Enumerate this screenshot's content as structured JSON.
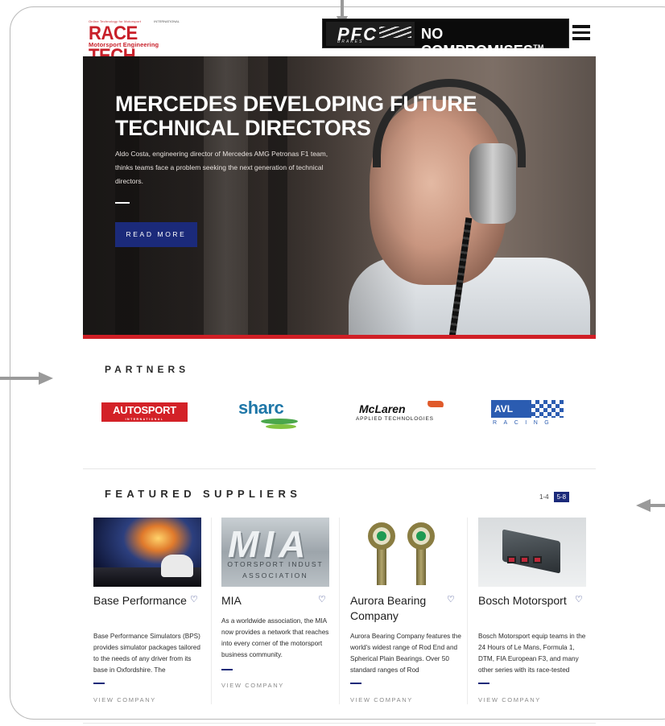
{
  "header": {
    "logo_top_left": "Online Technology for Motorsport",
    "logo_top_right": "INTERNATIONAL",
    "logo_main": "RACE TECH",
    "logo_sub": "Motorsport Engineering",
    "ad_brand": "PFC",
    "ad_brand_sub": "BRAKES",
    "ad_tagline": "NO COMPROMISES",
    "ad_tm": "TM"
  },
  "hero": {
    "title": "MERCEDES DEVELOPING FUTURE TECHNICAL DIRECTORS",
    "blurb": "Aldo Costa, engineering director of Mercedes AMG Petronas F1 team, thinks teams face a problem seeking the next generation of technical directors.",
    "cta": "READ MORE"
  },
  "partners": {
    "title": "PARTNERS",
    "logos": [
      {
        "name": "AUTOSPORT",
        "sub": "INTERNATIONAL"
      },
      {
        "name": "sharc"
      },
      {
        "name": "McLaren",
        "sub": "APPLIED TECHNOLOGIES"
      },
      {
        "name": "AVL",
        "sub": "RACING"
      }
    ]
  },
  "suppliers": {
    "title": "FEATURED SUPPLIERS",
    "pager": [
      "1-4",
      "5-8"
    ],
    "cards": [
      {
        "name": "Base Performance",
        "desc": "Base Performance Simulators (BPS) provides simulator packages tailored to the needs of any driver from its base in Oxfordshire. The",
        "cta": "VIEW COMPANY"
      },
      {
        "name": "MIA",
        "desc": "As a worldwide association, the MIA now provides a network that reaches into every corner of the motorsport business community.",
        "cta": "VIEW COMPANY",
        "image_text": [
          "OTORSPORT INDUST",
          "ASSOCIATION"
        ]
      },
      {
        "name": "Aurora Bearing Company",
        "desc": "Aurora Bearing Company features the world's widest range of Rod End and Spherical Plain Bearings. Over 50 standard ranges of Rod",
        "cta": "VIEW COMPANY"
      },
      {
        "name": "Bosch Motorsport",
        "desc": "Bosch Motorsport equip teams in the 24 Hours of Le Mans, Formula 1, DTM, FIA European F3, and many other series with its race-tested",
        "cta": "VIEW COMPANY"
      }
    ]
  },
  "colors": {
    "brand_red": "#c8202a",
    "accent_blue": "#1b2a7a",
    "hero_bar": "#d01f26"
  }
}
